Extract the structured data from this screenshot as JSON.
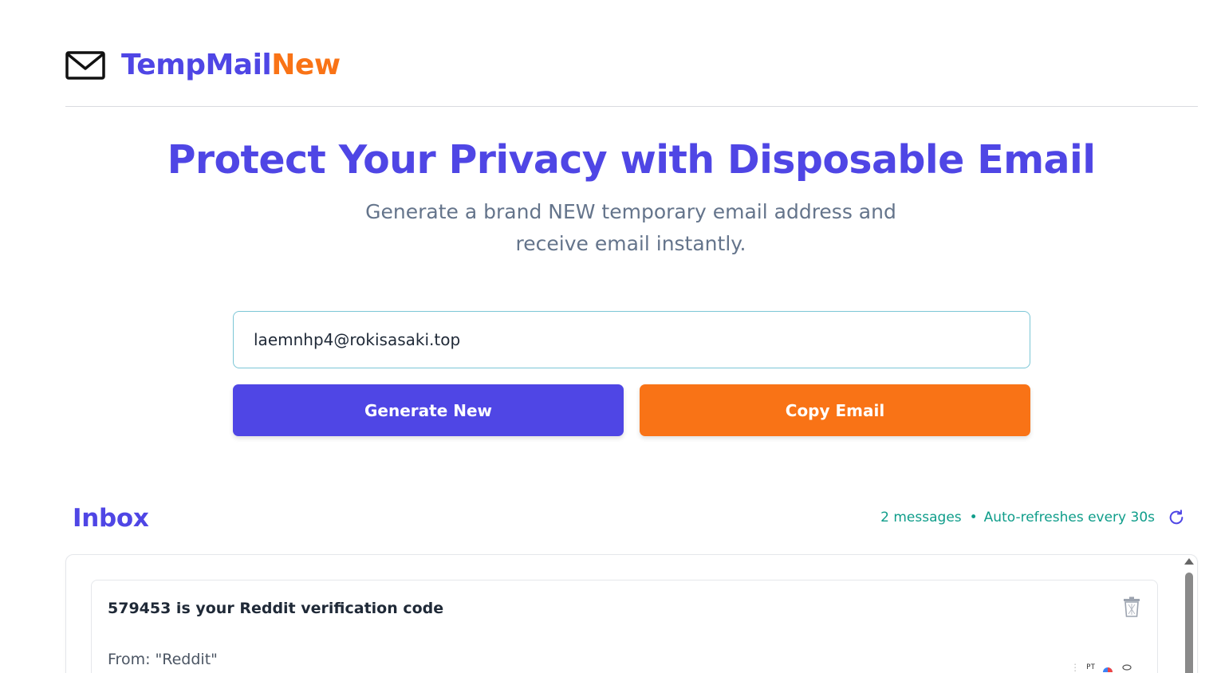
{
  "brand": {
    "name_part1": "TempMail",
    "name_part2": "New",
    "primary_color": "#4f46e5",
    "accent_color": "#f97316",
    "logo_icon": "envelope-icon"
  },
  "hero": {
    "title": "Protect Your Privacy with Disposable Email",
    "subtitle_line1": "Generate a brand NEW temporary email address and",
    "subtitle_line2": "receive email instantly."
  },
  "email": {
    "value": "laemnhp4@rokisasaki.top"
  },
  "actions": {
    "generate_label": "Generate New",
    "copy_label": "Copy Email"
  },
  "inbox": {
    "title": "Inbox",
    "message_count": "2 messages",
    "separator": "•",
    "auto_refresh": "Auto-refreshes every 30s",
    "refresh_icon": "refresh-icon",
    "messages": [
      {
        "subject": "579453 is your Reddit verification code",
        "from": "From: \"Reddit\"",
        "delete_icon": "trash-icon",
        "extra_text": "PT"
      }
    ]
  }
}
